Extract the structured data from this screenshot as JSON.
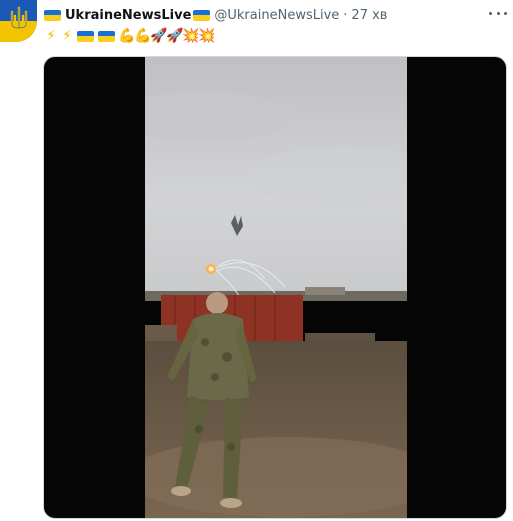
{
  "tweet": {
    "display_name": "UkraineNewsLive",
    "handle": "@UkraineNewsLive",
    "separator": "·",
    "time": "27 хв",
    "text_emojis": [
      "⚡",
      "⚡",
      "flag",
      "flag",
      "💪",
      "💪",
      "🚀",
      "🚀",
      "💥",
      "💥"
    ]
  },
  "colors": {
    "brand_blue": "#1c58b5",
    "brand_yellow": "#f4c400",
    "secondary_text": "#536471"
  }
}
